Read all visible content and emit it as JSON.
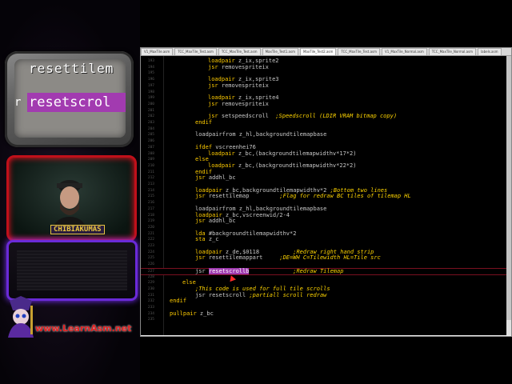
{
  "overlay": {
    "tv_line1": "resettilem",
    "tv_prefix": "r",
    "tv_line2": "resetscrol",
    "cam_logo": "CHIBIAKUMAS",
    "url": "www.LearnAsm.net"
  },
  "editor": {
    "tabs": [
      {
        "label": "V1_MaxTile.asm",
        "active": false
      },
      {
        "label": "TCC_MaxTile_Test.asm",
        "active": false
      },
      {
        "label": "TCC_MaxTile_Test.asm",
        "active": false
      },
      {
        "label": "MaxTile_Test1.asm",
        "active": false
      },
      {
        "label": "MaxTile_Test2.asm",
        "active": true
      },
      {
        "label": "TCC_MaxTile_Test.asm",
        "active": false
      },
      {
        "label": "V1_MaxTile_Normal.asm",
        "active": false
      },
      {
        "label": "TCC_MaxTile_Normal.asm",
        "active": false
      },
      {
        "label": "labels.asm",
        "active": false
      }
    ],
    "lines": [
      {
        "n": "193",
        "indent": 52,
        "op": "loadpair",
        "args": " z_ix,sprite2",
        "comment": ""
      },
      {
        "n": "194",
        "indent": 52,
        "op": "jsr",
        "args": " removespriteix",
        "comment": ""
      },
      {
        "n": "195",
        "indent": 0,
        "op": "",
        "args": "",
        "comment": ""
      },
      {
        "n": "196",
        "indent": 52,
        "op": "loadpair",
        "args": " z_ix,sprite3",
        "comment": ""
      },
      {
        "n": "197",
        "indent": 52,
        "op": "jsr",
        "args": " removespriteix",
        "comment": ""
      },
      {
        "n": "198",
        "indent": 0,
        "op": "",
        "args": "",
        "comment": ""
      },
      {
        "n": "199",
        "indent": 52,
        "op": "loadpair",
        "args": " z_ix,sprite4",
        "comment": ""
      },
      {
        "n": "200",
        "indent": 52,
        "op": "jsr",
        "args": " removespriteix",
        "comment": ""
      },
      {
        "n": "201",
        "indent": 0,
        "op": "",
        "args": "",
        "comment": ""
      },
      {
        "n": "202",
        "indent": 52,
        "op": "jsr",
        "args": " setspeedscroll  ",
        "comment": ";Speedscroll (LDIR VRAM bitmap copy)"
      },
      {
        "n": "203",
        "indent": 36,
        "op": "endif",
        "args": "",
        "comment": ""
      },
      {
        "n": "204",
        "indent": 0,
        "op": "",
        "args": "",
        "comment": ""
      },
      {
        "n": "205",
        "indent": 36,
        "op": "",
        "args": "loadpairfrom z_hl,backgroundtilemapbase",
        "comment": ""
      },
      {
        "n": "206",
        "indent": 0,
        "op": "",
        "args": "",
        "comment": ""
      },
      {
        "n": "207",
        "indent": 36,
        "op": "ifdef",
        "args": " vscreenhei76",
        "comment": ""
      },
      {
        "n": "208",
        "indent": 52,
        "op": "loadpair",
        "args": " z_bc,(backgroundtilemapwidthv*17*2)",
        "comment": ""
      },
      {
        "n": "209",
        "indent": 36,
        "op": "else",
        "args": "",
        "comment": ""
      },
      {
        "n": "210",
        "indent": 52,
        "op": "loadpair",
        "args": " z_bc,(backgroundtilemapwidthv*22*2)",
        "comment": ""
      },
      {
        "n": "211",
        "indent": 36,
        "op": "endif",
        "args": "",
        "comment": ""
      },
      {
        "n": "212",
        "indent": 36,
        "op": "jsr",
        "args": " addhl_bc",
        "comment": ""
      },
      {
        "n": "213",
        "indent": 0,
        "op": "",
        "args": "",
        "comment": ""
      },
      {
        "n": "214",
        "indent": 36,
        "op": "loadpair",
        "args": " z_bc,backgroundtilemapwidthv*2 ",
        "comment": ";Bottom two lines"
      },
      {
        "n": "215",
        "indent": 36,
        "op": "jsr",
        "args": " resettilemap         ",
        "comment": ";Flag for redraw BC tiles of tilemap HL"
      },
      {
        "n": "216",
        "indent": 0,
        "op": "",
        "args": "",
        "comment": ""
      },
      {
        "n": "217",
        "indent": 36,
        "op": "",
        "args": "loadpairfrom z_hl,backgroundtilemapbase",
        "comment": ""
      },
      {
        "n": "218",
        "indent": 36,
        "op": "loadpair",
        "args": " z_bc,vscreenwid/2-4",
        "comment": ""
      },
      {
        "n": "219",
        "indent": 36,
        "op": "jsr",
        "args": " addhl_bc",
        "comment": ""
      },
      {
        "n": "220",
        "indent": 0,
        "op": "",
        "args": "",
        "comment": ""
      },
      {
        "n": "221",
        "indent": 36,
        "op": "lda",
        "args": " #backgroundtilemapwidthv*2",
        "comment": ""
      },
      {
        "n": "222",
        "indent": 36,
        "op": "sta",
        "args": " z_c",
        "comment": ""
      },
      {
        "n": "223",
        "indent": 0,
        "op": "",
        "args": "",
        "comment": ""
      },
      {
        "n": "224",
        "indent": 36,
        "op": "loadpair",
        "args": " z_de,$0118          ",
        "comment": ";Redraw right hand strip"
      },
      {
        "n": "225",
        "indent": 36,
        "op": "jsr",
        "args": " resettilemappart     ",
        "comment": ";DE=WH C=Tilewidth HL=Tile src"
      },
      {
        "n": "226",
        "indent": 0,
        "op": "",
        "args": "",
        "comment": ""
      },
      {
        "n": "227",
        "indent": 36,
        "op": "",
        "args": "jsr ",
        "hl": "resetscrollb",
        "tail": "             ",
        "comment": ";Redraw Tilemap"
      },
      {
        "n": "228",
        "indent": 0,
        "op": "",
        "args": "",
        "comment": ""
      },
      {
        "n": "229",
        "indent": 20,
        "op": "else",
        "args": "",
        "comment": ""
      },
      {
        "n": "230",
        "indent": 36,
        "op": "",
        "args": "",
        "comment": ";This code is used for full tile scrolls"
      },
      {
        "n": "231",
        "indent": 36,
        "op": "",
        "args": "jsr resetscroll ",
        "comment": ";partiall scroll redraw"
      },
      {
        "n": "232",
        "indent": 4,
        "op": "endif",
        "args": "",
        "comment": ""
      },
      {
        "n": "233",
        "indent": 0,
        "op": "",
        "args": "",
        "comment": ""
      },
      {
        "n": "234",
        "indent": 4,
        "op": "pullpair",
        "args": " z_bc",
        "comment": ""
      },
      {
        "n": "235",
        "indent": 0,
        "op": "",
        "args": "",
        "comment": ""
      }
    ]
  }
}
